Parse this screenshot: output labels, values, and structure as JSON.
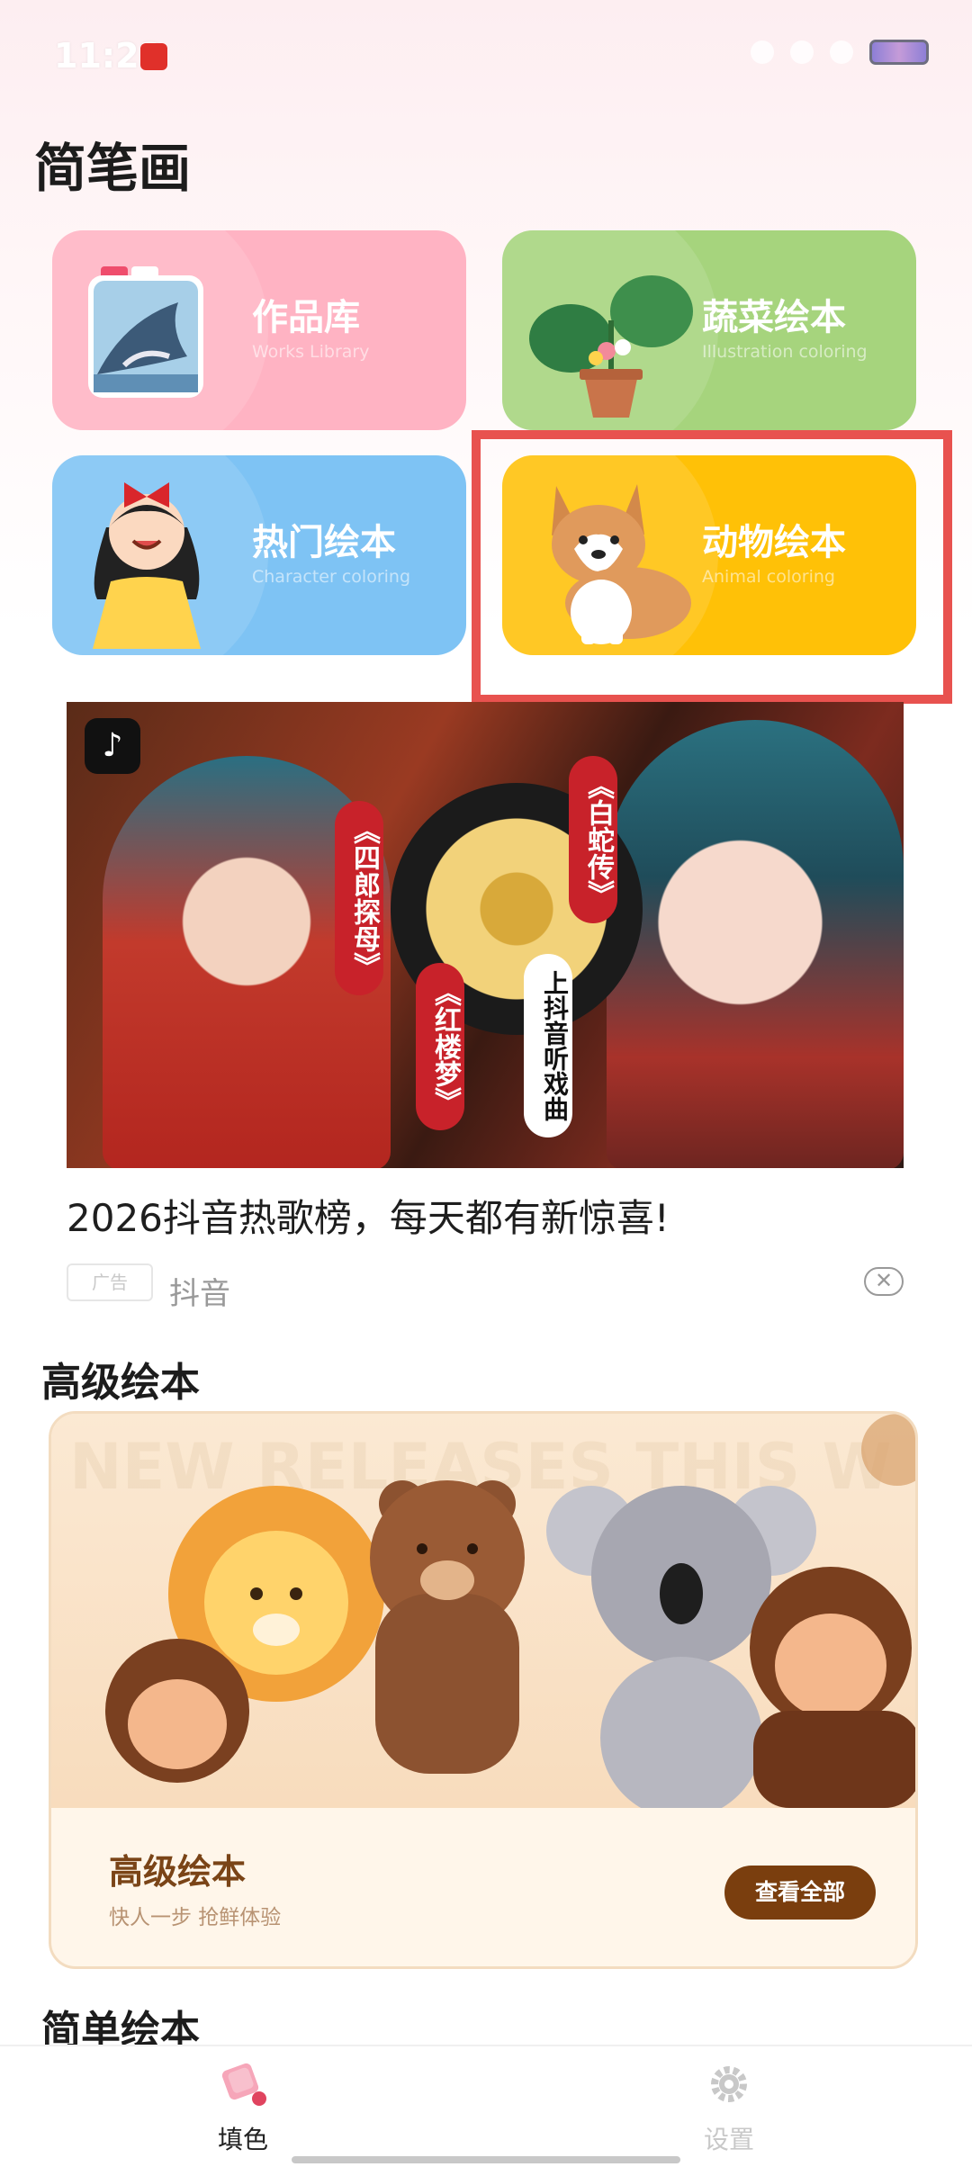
{
  "status_bar": {
    "time": "11:23"
  },
  "page_title": "简笔画",
  "categories": [
    {
      "name": "作品库",
      "subtitle": "Works Library"
    },
    {
      "name": "蔬菜绘本",
      "subtitle": "Illustration coloring"
    },
    {
      "name": "热门绘本",
      "subtitle": "Character coloring"
    },
    {
      "name": "动物绘本",
      "subtitle": "Animal coloring"
    }
  ],
  "ad": {
    "tags": [
      "《四郎探母》",
      "《白蛇传》",
      "《红楼梦》",
      "上抖音听戏曲"
    ],
    "title": "2026抖音热歌榜，每天都有新惊喜!",
    "badge": "广告",
    "source": "抖音",
    "close_symbol": "✕"
  },
  "sections": {
    "advanced": {
      "heading": "高级绘本",
      "watermark": "NEW RELEASES THIS W",
      "card_title": "高级绘本",
      "card_subtitle": "快人一步 抢鲜体验",
      "button": "查看全部"
    },
    "simple": {
      "heading": "简单绘本"
    }
  },
  "bottom_nav": [
    {
      "label": "填色",
      "icon": "paint-bucket-icon",
      "active": true,
      "color": "#222222"
    },
    {
      "label": "设置",
      "icon": "gear-icon",
      "active": false,
      "color": "#c8c8c8"
    }
  ]
}
